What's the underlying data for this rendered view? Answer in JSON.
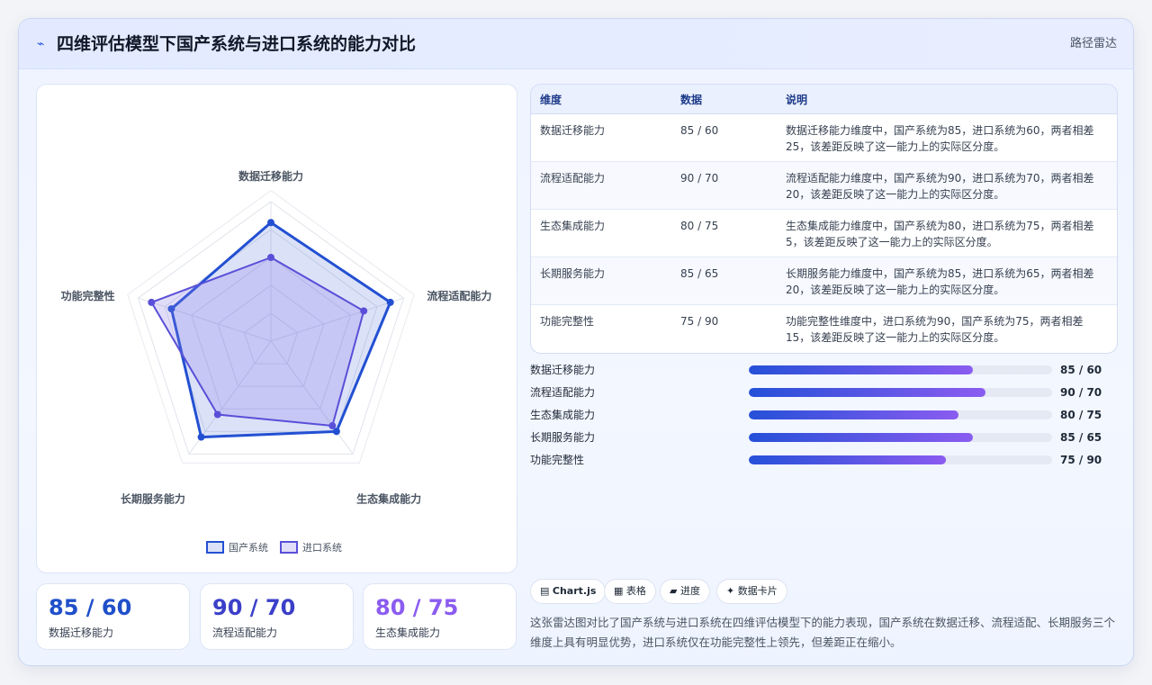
{
  "header": {
    "title": "四维评估模型下国产系统与进口系统的能力对比",
    "tag": "路径雷达"
  },
  "chart_data": {
    "type": "radar",
    "categories": [
      "数据迁移能力",
      "流程适配能力",
      "生态集成能力",
      "长期服务能力",
      "功能完整性"
    ],
    "series": [
      {
        "name": "国产系统",
        "values": [
          85,
          90,
          80,
          85,
          75
        ],
        "color": "#2350d2"
      },
      {
        "name": "进口系统",
        "values": [
          60,
          70,
          75,
          65,
          90
        ],
        "color": "#5a4fd8"
      }
    ],
    "rlim": [
      0,
      100
    ],
    "grid": true,
    "legend": "bottom"
  },
  "stats": [
    {
      "value": "85 / 60",
      "label": "数据迁移能力",
      "color": "#1f4fc9"
    },
    {
      "value": "90 / 70",
      "label": "流程适配能力",
      "color": "#3b3fc8"
    },
    {
      "value": "80 / 75",
      "label": "生态集成能力",
      "color": "#8b5cf0"
    }
  ],
  "table": {
    "headers": [
      "维度",
      "数据",
      "说明"
    ],
    "rows": [
      {
        "dim": "数据迁移能力",
        "data": "85 / 60",
        "desc": "数据迁移能力维度中，国产系统为85，进口系统为60，两者相差25，该差距反映了这一能力上的实际区分度。"
      },
      {
        "dim": "流程适配能力",
        "data": "90 / 70",
        "desc": "流程适配能力维度中，国产系统为90，进口系统为70，两者相差20，该差距反映了这一能力上的实际区分度。"
      },
      {
        "dim": "生态集成能力",
        "data": "80 / 75",
        "desc": "生态集成能力维度中，国产系统为80，进口系统为75，两者相差5，该差距反映了这一能力上的实际区分度。"
      },
      {
        "dim": "长期服务能力",
        "data": "85 / 65",
        "desc": "长期服务能力维度中，国产系统为85，进口系统为65，两者相差20，该差距反映了这一能力上的实际区分度。"
      },
      {
        "dim": "功能完整性",
        "data": "75 / 90",
        "desc": "功能完整性维度中，进口系统为90，国产系统为75，两者相差15，该差距反映了这一能力上的实际区分度。"
      }
    ]
  },
  "bars": [
    {
      "label": "数据迁移能力",
      "value": "85 / 60",
      "level": 0.74
    },
    {
      "label": "流程适配能力",
      "value": "90 / 70",
      "level": 0.78
    },
    {
      "label": "生态集成能力",
      "value": "80 / 75",
      "level": 0.69
    },
    {
      "label": "长期服务能力",
      "value": "85 / 65",
      "level": 0.74
    },
    {
      "label": "功能完整性",
      "value": "75 / 90",
      "level": 0.65
    }
  ],
  "chips": [
    {
      "icon": "▤",
      "label": "Chart.js",
      "icon_name": "chart-icon"
    },
    {
      "icon": "▦",
      "label": "表格",
      "icon_name": "table-icon"
    },
    {
      "icon": "▰",
      "label": "进度",
      "icon_name": "progress-icon"
    },
    {
      "icon": "✦",
      "label": "数据卡片",
      "icon_name": "sparkle-icon"
    }
  ],
  "summary": "这张雷达图对比了国产系统与进口系统在四维评估模型下的能力表现，国产系统在数据迁移、流程适配、长期服务三个维度上具有明显优势，进口系统仅在功能完整性上领先，但差距正在缩小。"
}
